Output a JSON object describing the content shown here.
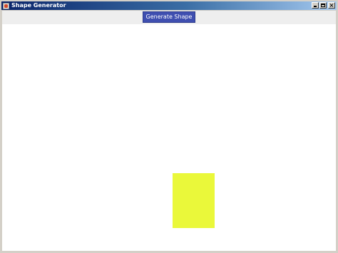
{
  "window": {
    "title": "Shape Generator"
  },
  "titlebar": {
    "icon": "java-app-icon",
    "minimize_glyph": "minimize-icon",
    "maximize_glyph": "maximize-icon",
    "close_glyph": "×"
  },
  "toolbar": {
    "generate_label": "Generate Shape"
  },
  "canvas": {
    "shape": {
      "type": "rectangle",
      "color": "#eaf83a"
    }
  },
  "colors": {
    "button_bg": "#3f4fb0",
    "toolbar_bg": "#eeeeee",
    "canvas_bg": "#ffffff"
  }
}
